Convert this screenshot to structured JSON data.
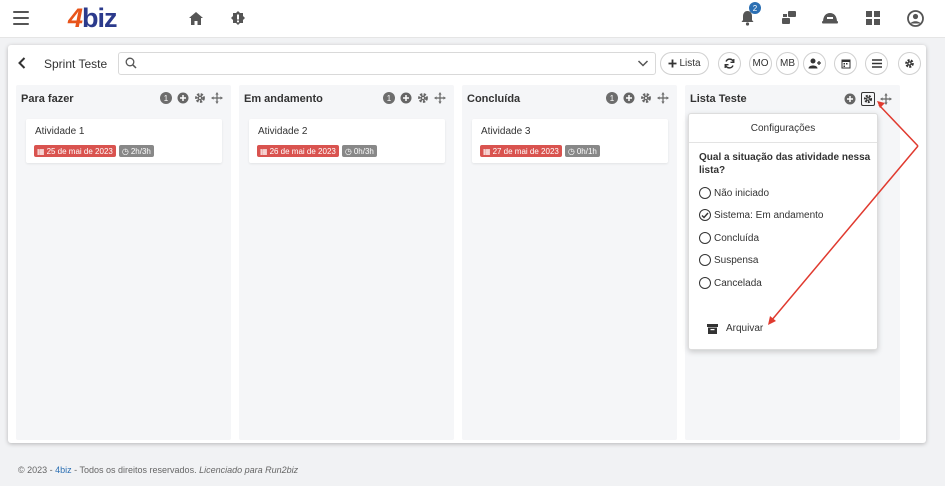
{
  "logo": {
    "number": "4",
    "text": "biz"
  },
  "topbar": {
    "notification_count": "2"
  },
  "board": {
    "title": "Sprint Teste"
  },
  "toolbar": {
    "add_list_label": "Lista",
    "member1": "MO",
    "member2": "MB"
  },
  "columns": [
    {
      "title": "Para fazer",
      "count": "1",
      "card": {
        "title": "Atividade 1",
        "date": "25 de mai de 2023",
        "time": "2h/3h"
      }
    },
    {
      "title": "Em andamento",
      "count": "1",
      "card": {
        "title": "Atividade 2",
        "date": "26 de mai de 2023",
        "time": "0h/3h"
      }
    },
    {
      "title": "Concluída",
      "count": "1",
      "card": {
        "title": "Atividade 3",
        "date": "27 de mai de 2023",
        "time": "0h/1h"
      }
    },
    {
      "title": "Lista Teste"
    }
  ],
  "popup": {
    "title": "Configurações",
    "question": "Qual a situação das atividade nessa lista?",
    "options": [
      {
        "label": "Não iniciado",
        "checked": false
      },
      {
        "label": "Sistema: Em andamento",
        "checked": true
      },
      {
        "label": "Concluída",
        "checked": false
      },
      {
        "label": "Suspensa",
        "checked": false
      },
      {
        "label": "Cancelada",
        "checked": false
      }
    ],
    "archive_label": "Arquivar"
  },
  "footer": {
    "prefix": "© 2023 - ",
    "brand": "4biz",
    "middle": " - Todos os direitos reservados. ",
    "license": "Licenciado para Run2biz"
  },
  "colors": {
    "accent": "#e8541a",
    "brand": "#2b3a8c",
    "date_tag": "#d9534f",
    "arrow": "#e03a2f"
  }
}
